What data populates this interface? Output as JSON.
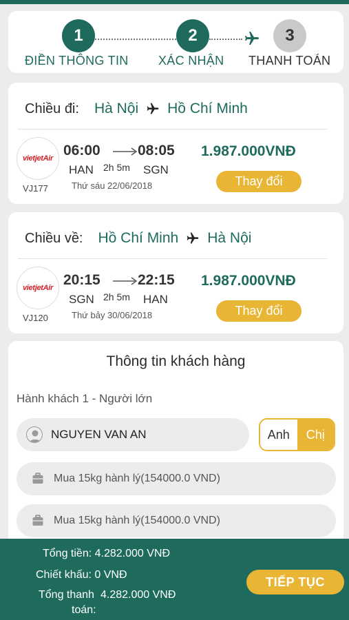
{
  "stepper": {
    "steps": [
      {
        "number": "1",
        "label": "ĐIỀN THÔNG TIN"
      },
      {
        "number": "2",
        "label": "XÁC NHẬN"
      },
      {
        "number": "3",
        "label": "THANH TOÁN"
      }
    ]
  },
  "outbound": {
    "direction_label": "Chiều đi:",
    "from_city": "Hà Nội",
    "to_city": "Hồ Chí Minh",
    "airline_logo": "vietjetAir",
    "flight_code": "VJ177",
    "depart_time": "06:00",
    "arrive_time": "08:05",
    "depart_airport": "HAN",
    "arrive_airport": "SGN",
    "duration": "2h 5m",
    "date": "Thứ sáu 22/06/2018",
    "price": "1.987.000VNĐ",
    "change_label": "Thay đổi"
  },
  "return": {
    "direction_label": "Chiều về:",
    "from_city": "Hồ Chí Minh",
    "to_city": "Hà Nội",
    "airline_logo": "vietjetAir",
    "flight_code": "VJ120",
    "depart_time": "20:15",
    "arrive_time": "22:15",
    "depart_airport": "SGN",
    "arrive_airport": "HAN",
    "duration": "2h 5m",
    "date": "Thứ bảy 30/06/2018",
    "price": "1.987.000VNĐ",
    "change_label": "Thay đổi"
  },
  "customer": {
    "title": "Thông tin khách hàng",
    "passenger_label": "Hành khách 1 - Người lớn",
    "name_value": "NGUYEN VAN AN",
    "gender_options": [
      "Anh",
      "Chị"
    ],
    "gender_selected": "Chị",
    "baggage": [
      "Mua 15kg hành lý(154000.0 VND)",
      "Mua 15kg hành lý(154000.0 VND)"
    ]
  },
  "footer": {
    "total_label": "Tổng tiền:",
    "total_value": "4.282.000 VNĐ",
    "discount_label": "Chiết khấu:",
    "discount_value": "0 VNĐ",
    "pay_label_line1": "Tổng thanh",
    "pay_label_line2": "toán:",
    "pay_value": "4.282.000 VNĐ",
    "next_label": "TIẾP TỤC"
  },
  "colors": {
    "primary": "#1e6b5d",
    "accent": "#e8b634",
    "brand_red": "#d62027"
  }
}
